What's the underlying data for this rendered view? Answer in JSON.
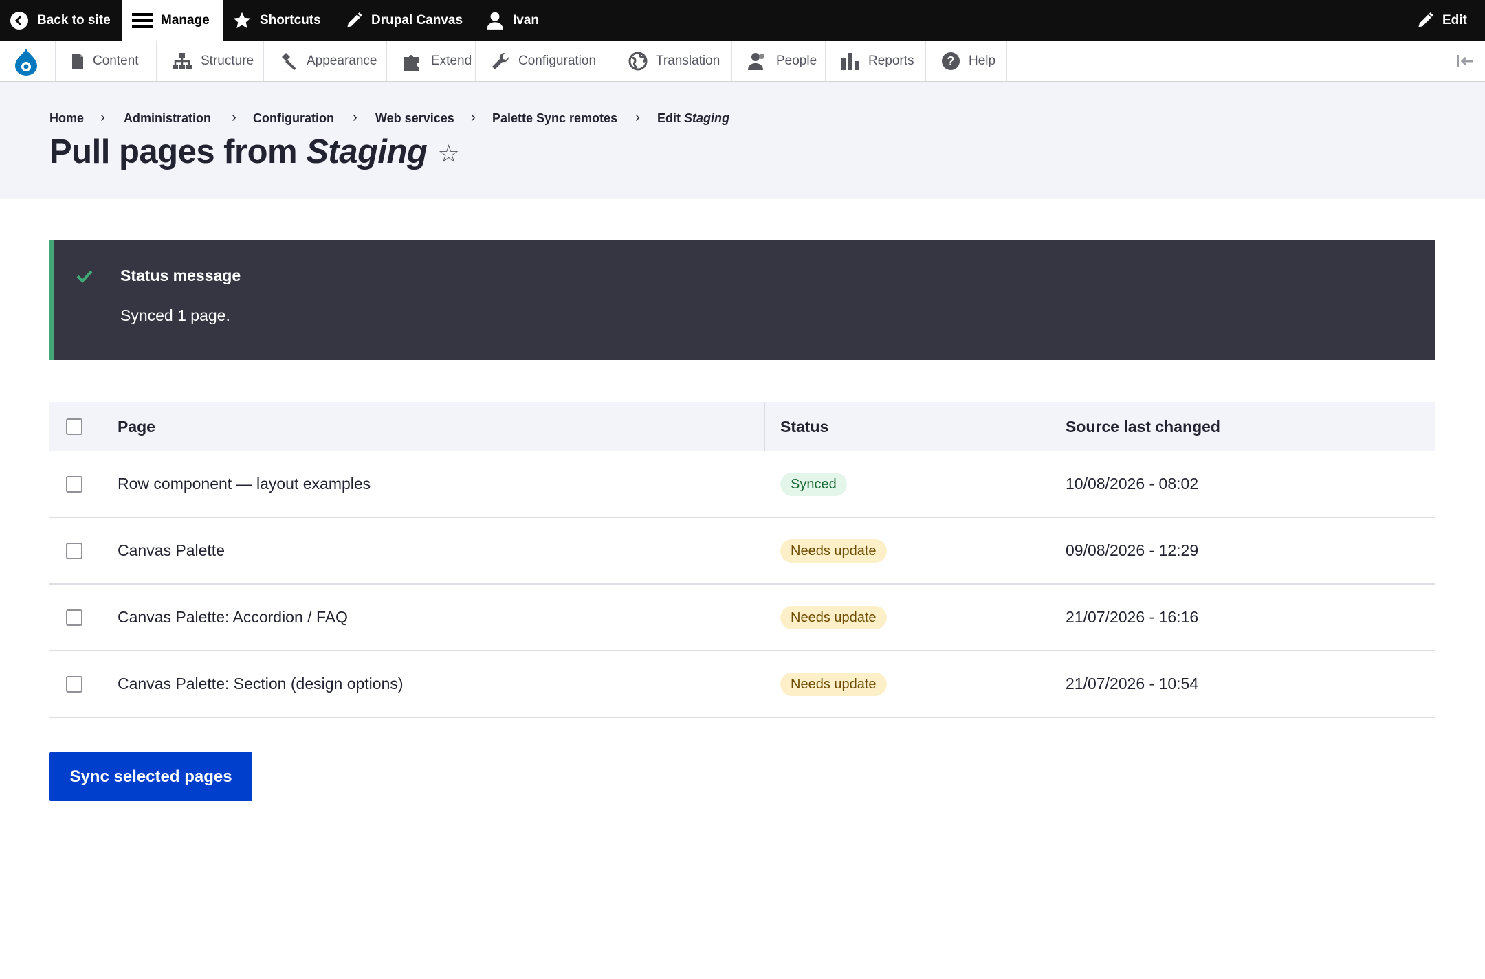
{
  "toolbar": {
    "back_to_site": "Back to site",
    "manage": "Manage",
    "shortcuts": "Shortcuts",
    "drupal_canvas": "Drupal Canvas",
    "user": "Ivan",
    "edit": "Edit"
  },
  "menu": {
    "items": [
      {
        "label": "Content",
        "icon": "file-icon"
      },
      {
        "label": "Structure",
        "icon": "sitemap-icon"
      },
      {
        "label": "Appearance",
        "icon": "paintbrush-icon"
      },
      {
        "label": "Extend",
        "icon": "puzzle-icon"
      },
      {
        "label": "Configuration",
        "icon": "wrench-icon"
      },
      {
        "label": "Translation",
        "icon": "globe-icon"
      },
      {
        "label": "People",
        "icon": "people-icon"
      },
      {
        "label": "Reports",
        "icon": "bar-chart-icon"
      },
      {
        "label": "Help",
        "icon": "help-icon"
      }
    ]
  },
  "breadcrumb": {
    "items": [
      "Home",
      "Administration",
      "Configuration",
      "Web services",
      "Palette Sync remotes"
    ],
    "last_prefix": "Edit",
    "last_emphasis": "Staging",
    "separator": "›"
  },
  "page": {
    "title_prefix": "Pull pages from",
    "title_emphasis": "Staging",
    "star": "☆"
  },
  "status": {
    "heading": "Status message",
    "text": "Synced 1 page."
  },
  "table": {
    "headers": {
      "page": "Page",
      "status": "Status",
      "changed": "Source last changed"
    },
    "rows": [
      {
        "page": "Row component — layout examples",
        "status": "Synced",
        "changed": "10/08/2026 - 08:02"
      },
      {
        "page": "Canvas Palette",
        "status": "Needs update",
        "changed": "09/08/2026 - 12:29"
      },
      {
        "page": "Canvas Palette: Accordion / FAQ",
        "status": "Needs update",
        "changed": "21/07/2026 - 16:16"
      },
      {
        "page": "Canvas Palette: Section (design options)",
        "status": "Needs update",
        "changed": "21/07/2026 - 10:54"
      }
    ]
  },
  "actions": {
    "sync_button": "Sync selected pages"
  },
  "colors": {
    "primary": "#003ecc",
    "status_bg": "#353641",
    "status_accent": "#42a877",
    "toolbar_bg": "#0f0f0f"
  }
}
